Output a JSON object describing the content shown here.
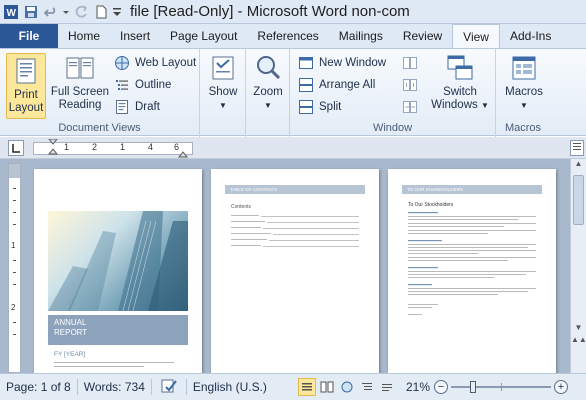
{
  "title": "file [Read-Only]  -  Microsoft Word non-com",
  "tabs": [
    {
      "label": "File"
    },
    {
      "label": "Home"
    },
    {
      "label": "Insert"
    },
    {
      "label": "Page Layout"
    },
    {
      "label": "References"
    },
    {
      "label": "Mailings"
    },
    {
      "label": "Review"
    },
    {
      "label": "View"
    },
    {
      "label": "Add-Ins"
    }
  ],
  "ribbon": {
    "document_views": {
      "label": "Document Views",
      "print_layout_1": "Print",
      "print_layout_2": "Layout",
      "full_screen_1": "Full Screen",
      "full_screen_2": "Reading",
      "web_layout": "Web Layout",
      "outline": "Outline",
      "draft": "Draft"
    },
    "show": "Show",
    "zoom": "Zoom",
    "window": {
      "label": "Window",
      "new_window": "New Window",
      "arrange_all": "Arrange All",
      "split": "Split",
      "switch_1": "Switch",
      "switch_2": "Windows"
    },
    "macros": {
      "label": "Macros",
      "button": "Macros"
    }
  },
  "ruler": {
    "marks": [
      "1",
      "2",
      "1",
      "4",
      "6"
    ]
  },
  "pages": {
    "cover_title_1": "ANNUAL",
    "cover_title_2": "REPORT",
    "cover_fy": "FY [YEAR]",
    "toc_heading": "TABLE OF CONTENTS",
    "toc_sub": "Contents",
    "letter_heading": "TO OUR SHAREHOLDERS",
    "letter_sub": "To Our Stockholders"
  },
  "status": {
    "page": "Page: 1 of 8",
    "words": "Words: 734",
    "language": "English (U.S.)",
    "zoom": "21%"
  },
  "colors": {
    "accent": "#2b5797",
    "ribbon_bg": "#e3ecf7",
    "doc_bg": "#a9b9cd",
    "cover_band": "#8da2bb"
  }
}
